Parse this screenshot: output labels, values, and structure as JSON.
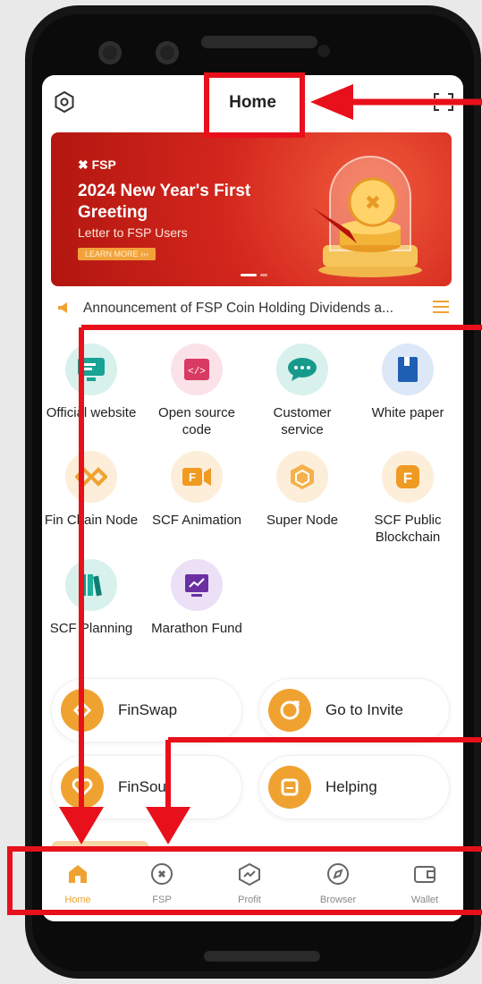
{
  "header": {
    "title": "Home"
  },
  "banner": {
    "brand": "FSP",
    "headline": "2024 New Year's First Greeting",
    "subtitle": "Letter to FSP Users",
    "cta": "LEARN MORE"
  },
  "announcement": {
    "text": "Announcement of FSP Coin Holding Dividends a..."
  },
  "apps": [
    {
      "label": "Official website",
      "icon": "monitor-icon"
    },
    {
      "label": "Open source code",
      "icon": "code-icon"
    },
    {
      "label": "Customer service",
      "icon": "chat-icon"
    },
    {
      "label": "White paper",
      "icon": "book-icon"
    },
    {
      "label": "Fin Chain Node",
      "icon": "finchain-icon"
    },
    {
      "label": "SCF Animation",
      "icon": "animation-icon"
    },
    {
      "label": "Super Node",
      "icon": "cube-icon"
    },
    {
      "label": "SCF Public Blockchain",
      "icon": "blockchain-icon"
    },
    {
      "label": "SCF Planning",
      "icon": "books-icon"
    },
    {
      "label": "Marathon Fund",
      "icon": "chart-icon"
    }
  ],
  "quick_actions": [
    {
      "label": "FinSwap",
      "icon": "swap-icon"
    },
    {
      "label": "Go to Invite",
      "icon": "invite-icon"
    },
    {
      "label": "FinSoul",
      "icon": "heart-icon"
    },
    {
      "label": "Helping",
      "icon": "help-icon"
    }
  ],
  "tabs": [
    {
      "label": "Home",
      "icon": "home-icon",
      "active": true
    },
    {
      "label": "FSP",
      "icon": "fsp-icon",
      "active": false
    },
    {
      "label": "Profit",
      "icon": "profit-icon",
      "active": false
    },
    {
      "label": "Browser",
      "icon": "compass-icon",
      "active": false
    },
    {
      "label": "Wallet",
      "icon": "wallet-icon",
      "active": false
    }
  ],
  "colors": {
    "accent": "#f0a231",
    "annotation": "#e8101b",
    "banner": "#d3261d"
  }
}
